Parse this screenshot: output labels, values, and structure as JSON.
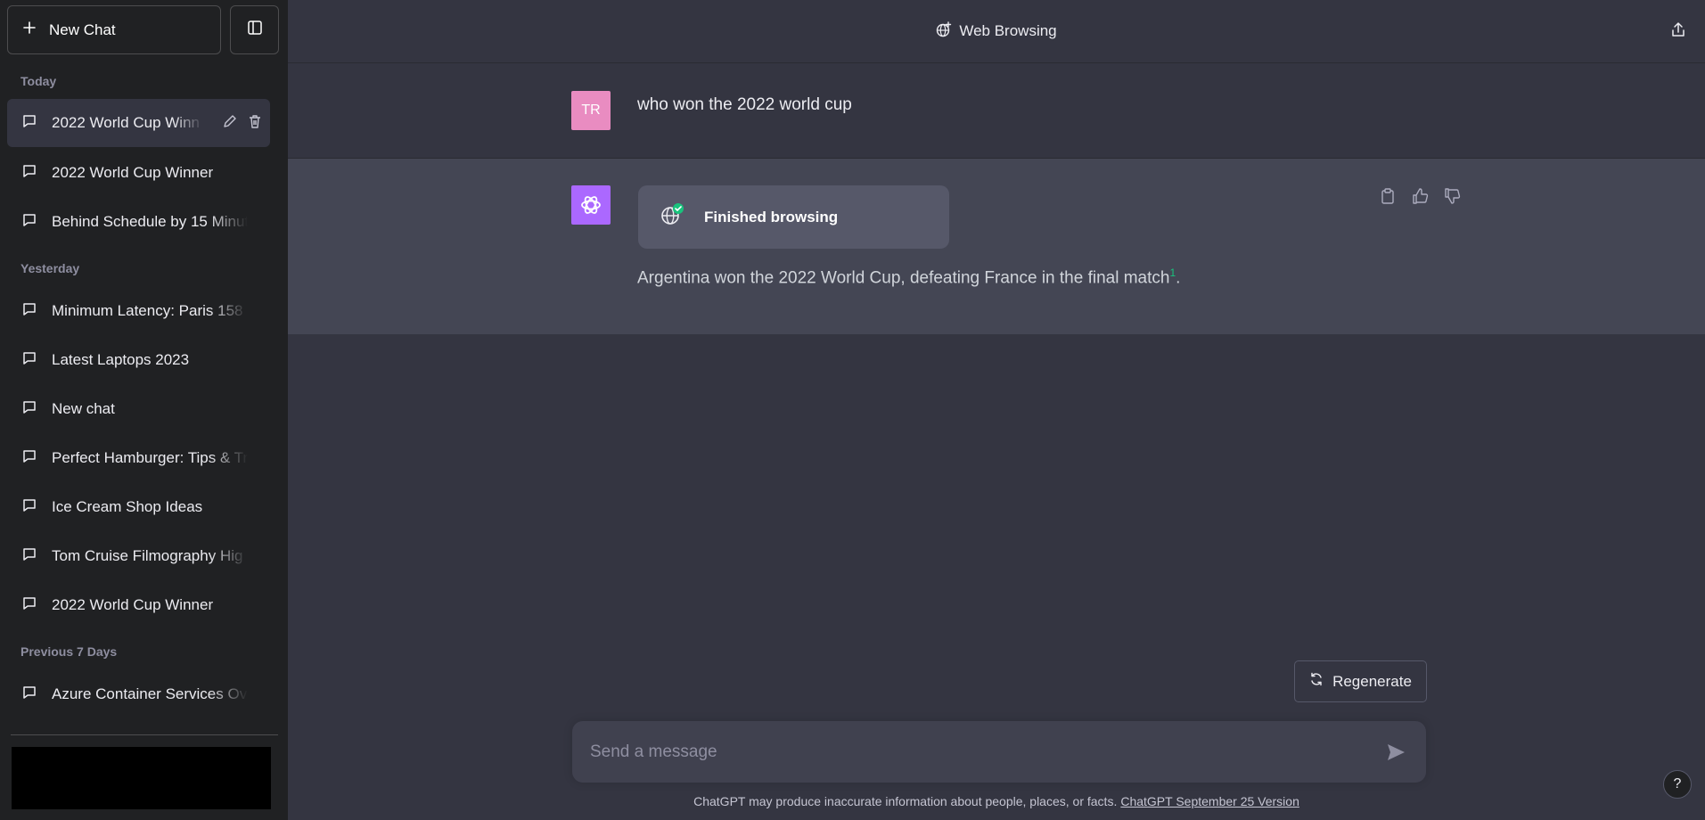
{
  "sidebar": {
    "new_chat_label": "New Chat",
    "sections": {
      "today": "Today",
      "yesterday": "Yesterday",
      "previous7": "Previous 7 Days"
    },
    "items": [
      {
        "label": "2022 World Cup Winn",
        "active": true
      },
      {
        "label": "2022 World Cup Winner"
      },
      {
        "label": "Behind Schedule by 15 Minut"
      },
      {
        "label": "Minimum Latency: Paris 158"
      },
      {
        "label": "Latest Laptops 2023"
      },
      {
        "label": "New chat"
      },
      {
        "label": "Perfect Hamburger: Tips & Tr"
      },
      {
        "label": "Ice Cream Shop Ideas"
      },
      {
        "label": "Tom Cruise Filmography Hig"
      },
      {
        "label": "2022 World Cup Winner"
      },
      {
        "label": "Azure Container Services Ov"
      }
    ]
  },
  "header": {
    "title": "Web Browsing"
  },
  "conversation": {
    "user_avatar": "TR",
    "user_message": "who won the 2022 world cup",
    "browse_status": "Finished browsing",
    "bot_message": "Argentina won the 2022 World Cup, defeating France in the final match",
    "citation": "1",
    "bot_message_end": "."
  },
  "composer": {
    "regenerate_label": "Regenerate",
    "placeholder": "Send a message"
  },
  "footer": {
    "disclaimer": "ChatGPT may produce inaccurate information about people, places, or facts.",
    "version_link": "ChatGPT September 25 Version",
    "help_label": "?"
  },
  "colors": {
    "sidebar_bg": "#202123",
    "main_bg": "#343541",
    "bot_bg": "#444654",
    "user_avatar": "#e98cc1",
    "bot_avatar": "#ab68ff",
    "citation": "#19c37d"
  }
}
